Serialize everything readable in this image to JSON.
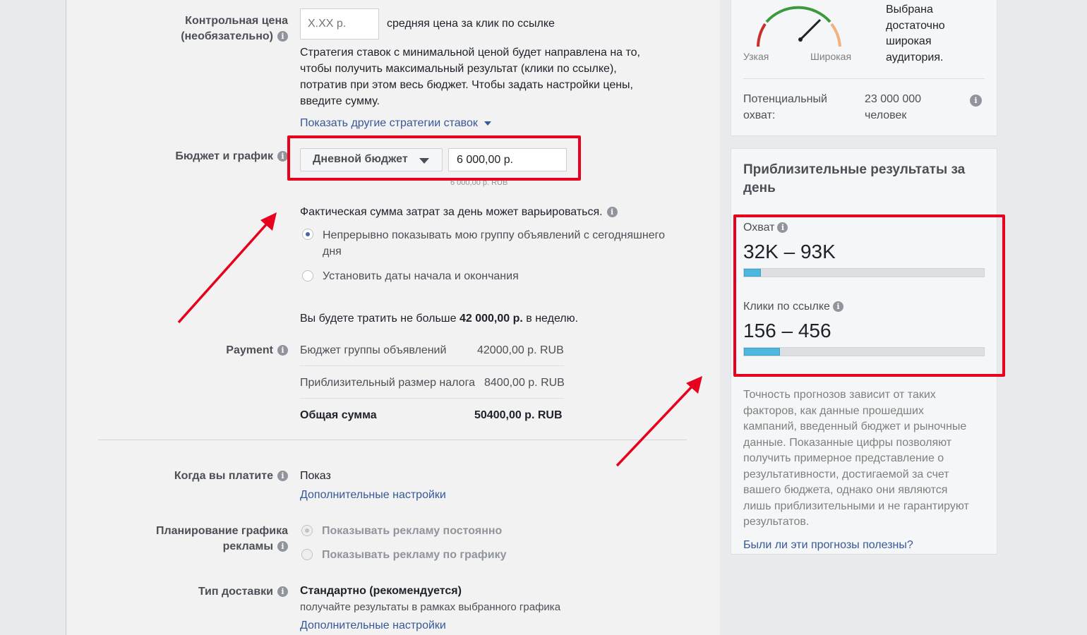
{
  "bid": {
    "label_line1": "Контрольная цена",
    "label_line2": "(необязательно)",
    "input_placeholder": "X.XX р.",
    "input_suffix": "средняя цена за клик по ссылке",
    "description": [
      "Стратегия ставок с минимальной ценой будет направлена на то,",
      "чтобы получить максимальный результат (клики по ссылке),",
      "потратив при этом весь бюджет. Чтобы задать настройки цены,",
      "введите сумму."
    ],
    "more_strategies_link": "Показать другие стратегии ставок"
  },
  "budget": {
    "label": "Бюджет и график",
    "type_select": "Дневной бюджет",
    "amount_value": "6 000,00 р.",
    "amount_hint": "6 000,00 р. RUB",
    "variance_note": "Фактическая сумма затрат за день может варьироваться.",
    "option_continuous_line1": "Непрерывно показывать мою группу объявлений с сегодняшнего",
    "option_continuous_line2": "дня",
    "option_dates": "Установить даты начала и окончания",
    "weekly_prefix": "Вы будете тратить не больше ",
    "weekly_amount": "42 000,00 р.",
    "weekly_suffix": " в неделю."
  },
  "payment": {
    "label": "Payment",
    "rows": [
      {
        "name": "Бюджет группы объявлений",
        "value": "42000,00 р. RUB"
      },
      {
        "name": "Приблизительный размер налога",
        "value": "8400,00 р. RUB"
      },
      {
        "name": "Общая сумма",
        "value": "50400,00 р. RUB"
      }
    ]
  },
  "when_pay": {
    "label": "Когда вы платите",
    "value": "Показ",
    "more_link": "Дополнительные настройки"
  },
  "schedule": {
    "label_line1": "Планирование графика",
    "label_line2": "рекламы",
    "option_always": "Показывать рекламу постоянно",
    "option_schedule": "Показывать рекламу по графику"
  },
  "delivery": {
    "label": "Тип доставки",
    "value": "Стандартно (рекомендуется)",
    "description": "получайте результаты в рамках выбранного графика",
    "more_link": "Дополнительные настройки"
  },
  "audience": {
    "gauge_narrow": "Узкая",
    "gauge_wide": "Широкая",
    "summary_lines": [
      "Выбрана",
      "достаточно",
      "широкая",
      "аудитория."
    ],
    "reach_label_line1": "Потенциальный",
    "reach_label_line2": "охват:",
    "reach_value_line1": "23 000 000",
    "reach_value_line2": "человек"
  },
  "estimates": {
    "title_line1": "Приблизительные результаты за",
    "title_line2": "день",
    "reach_label": "Охват",
    "reach_range": "32K – 93K",
    "reach_fill": 0.07,
    "clicks_label": "Клики по ссылке",
    "clicks_range": "156 – 456",
    "clicks_fill": 0.15,
    "disclaimer": [
      "Точность прогнозов зависит от таких",
      "факторов, как данные прошедших",
      "кампаний, введенный бюджет и рыночные",
      "данные. Показанные цифры позволяют",
      "получить примерное представление о",
      "результативности, достигаемой за счет",
      "вашего бюджета, однако они являются",
      "лишь приблизительными и не гарантируют",
      "результатов."
    ],
    "feedback_link": "Были ли эти прогнозы полезны?"
  },
  "colors": {
    "annotation_red": "#e8001c",
    "link_blue": "#365899",
    "bar_blue": "#4cb8e0"
  }
}
